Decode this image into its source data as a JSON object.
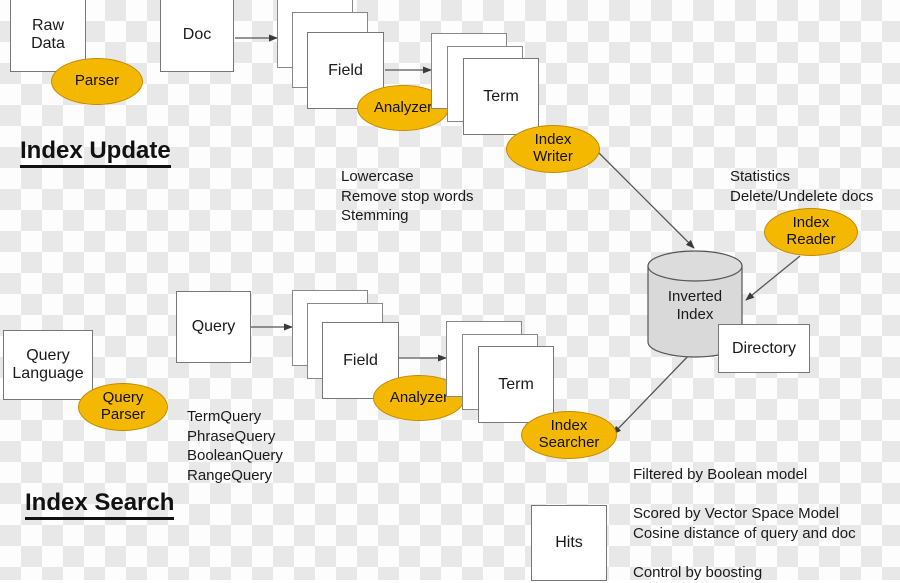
{
  "diagram": {
    "title": "Lucene Index Update and Index Search flow",
    "colors": {
      "ellipse_fill": "#f5b800",
      "ellipse_stroke": "#c08c00",
      "box_fill": "#ffffff",
      "box_stroke": "#777777",
      "cylinder_fill": "#d9d9d9",
      "cylinder_stroke": "#555555",
      "text": "#1a1a1a",
      "edge": "#555555"
    },
    "headings": [
      {
        "id": "index-update",
        "label": "Index Update"
      },
      {
        "id": "index-search",
        "label": "Index Search"
      }
    ],
    "boxes": [
      {
        "id": "raw-data",
        "label": "Raw\nData"
      },
      {
        "id": "doc",
        "label": "Doc"
      },
      {
        "id": "field-top",
        "label": "Field"
      },
      {
        "id": "term-top",
        "label": "Term"
      },
      {
        "id": "directory",
        "label": "Directory"
      },
      {
        "id": "query-language",
        "label": "Query\nLanguage"
      },
      {
        "id": "query",
        "label": "Query"
      },
      {
        "id": "field-bottom",
        "label": "Field"
      },
      {
        "id": "term-bottom",
        "label": "Term"
      },
      {
        "id": "hits",
        "label": "Hits"
      }
    ],
    "ellipses": [
      {
        "id": "parser",
        "label": "Parser"
      },
      {
        "id": "analyzer-top",
        "label": "Analyzer"
      },
      {
        "id": "index-writer",
        "label": "Index\nWriter"
      },
      {
        "id": "index-reader",
        "label": "Index\nReader"
      },
      {
        "id": "query-parser",
        "label": "Query\nParser"
      },
      {
        "id": "analyzer-bottom",
        "label": "Analyzer"
      },
      {
        "id": "index-searcher",
        "label": "Index\nSearcher"
      }
    ],
    "cylinder": {
      "id": "inverted-index",
      "label": "Inverted\nIndex"
    },
    "notes": [
      {
        "id": "analyzer-note",
        "label": "Lowercase\nRemove stop words\nStemming"
      },
      {
        "id": "index-reader-note",
        "label": "Statistics\nDelete/Undelete docs"
      },
      {
        "id": "query-types-note",
        "label": "TermQuery\nPhraseQuery\nBooleanQuery\nRangeQuery"
      },
      {
        "id": "boolean-model-note",
        "label": "Filtered by Boolean model"
      },
      {
        "id": "scoring-note",
        "label": "Scored by Vector Space Model\nCosine distance of query and doc"
      },
      {
        "id": "boosting-note",
        "label": "Control by boosting"
      }
    ]
  }
}
